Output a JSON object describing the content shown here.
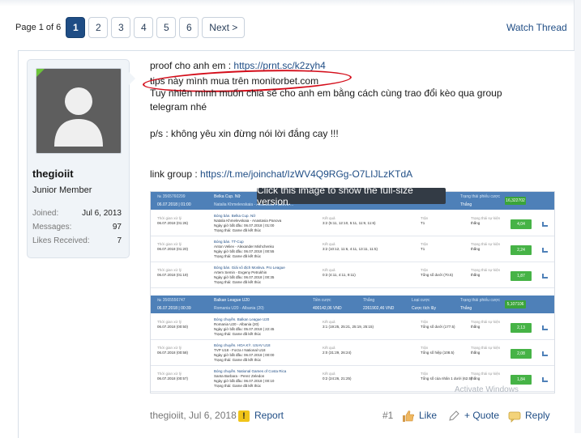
{
  "pagination": {
    "info": "Page 1 of 6",
    "pages": [
      "1",
      "2",
      "3",
      "4",
      "5",
      "6"
    ],
    "active": "1",
    "next": "Next >"
  },
  "watch_thread": "Watch Thread",
  "user": {
    "name": "thegioiit",
    "title": "Junior Member",
    "stats": [
      {
        "label": "Joined:",
        "value": "Jul 6, 2013"
      },
      {
        "label": "Messages:",
        "value": "97"
      },
      {
        "label": "Likes Received:",
        "value": "7"
      }
    ]
  },
  "message": {
    "line1_prefix": "proof cho anh em : ",
    "line1_link": "https://prnt.sc/k2zyh4",
    "line2": "tips này mình mua trên monitorbet.com",
    "line3": "Tuy nhiên mình muốn chia sẽ cho anh em bằng cách cùng trao đổi kèo qua group",
    "line4": "telegram nhé",
    "line5": "p/s : không yêu xin đừng nói lời đắng cay !!!",
    "line6_prefix": "link group : ",
    "line6_link": "https://t.me/joinchat/IzWV4Q9RGg-O7LIJLzKTdA"
  },
  "image": {
    "tooltip": "Click this image to show the full-size version.",
    "watermark": "Activate Windows",
    "blocks": [
      {
        "id": "№ 3565760299",
        "date": "06.07.2018 | 01:00",
        "league": "Belka Cup. Nữ",
        "match": "Natalia Khmelevskaia - Anastasia Panova ...",
        "status_label": "Trạng thái phiếu cược",
        "status": "Thắng",
        "badge": "16,322702",
        "rows": [
          {
            "time_label": "Thời gian xử lý",
            "time": "06.07.2018 (01:26)",
            "sport": "Bóng bàn. Belka Cup. Nữ",
            "teams": "Natalia Khmelevskaia - Anastasia Panova",
            "start": "Ngày giờ bắt đầu: 06.07.2018 | 01:00",
            "state": "Trạng thái: Game đã kết thúc",
            "result_label": "Kết quả",
            "result": "3:2 (5:11, 12:10, 5:11, 11:9, 11:6)",
            "pick_label": "Trận",
            "pick": "T1",
            "event_label": "Trạng thái sự kiện",
            "event": "thắng",
            "odds": "4,04"
          },
          {
            "time_label": "Thời gian xử lý",
            "time": "06.07.2018 (01:20)",
            "sport": "Bóng bàn. TT-Cup",
            "teams": "Anton Veliev - Alexander Mishchenko",
            "start": "Ngày giờ bắt đầu: 06.07.2018 | 00:55",
            "state": "Trạng thái: Game đã kết thúc",
            "result_label": "Kết quả",
            "result": "3:2 (10:12, 11:6, 4:11, 13:11, 11:5)",
            "pick_label": "Trận",
            "pick": "T1",
            "event_label": "Trạng thái sự kiện",
            "event": "thắng",
            "odds": "2,24"
          },
          {
            "time_label": "Thời gian xử lý",
            "time": "06.07.2018 (01:19)",
            "sport": "Bóng bàn. Giải vô địch Moskva. Pro League",
            "teams": "Artem Semin - Evgeny Petrukhin",
            "start": "Ngày giờ bắt đầu: 06.07.2018 | 00:35",
            "state": "Trạng thái: Game đã kết thúc",
            "result_label": "Kết quả",
            "result": "0:3 (4:11, 4:11, 9:11)",
            "pick_label": "Trận",
            "pick": "Tổng số dưới (70.5)",
            "event_label": "Trạng thái sự kiện",
            "event": "thắng",
            "odds": "1,87"
          }
        ]
      },
      {
        "id": "№ 3565556747",
        "date": "06.07.2018 | 00:39",
        "league": "Balkan League U20",
        "match": "Romania U20 - Albania (20)",
        "stake_label": "Tiền cược",
        "stake": "400142,06 VND",
        "win_label": "Thắng",
        "win": "2261902,46 VND",
        "type_label": "Loại cược",
        "type": "Cược tích lũy",
        "status_label": "Trạng thái phiếu cược",
        "status": "Thắng",
        "badge": "5,107106",
        "rows": [
          {
            "time_label": "Thời gian xử lý",
            "time": "06.07.2018 (00:50)",
            "sport": "Bóng chuyền. Balkan League U20",
            "teams": "Romania U20 - Albania (20)",
            "start": "Ngày giờ bắt đầu: 05.07.2018 | 22:45",
            "state": "Trạng thái: Game đã kết thúc",
            "result_label": "Kết quả",
            "result": "3:1 (19:25, 25:21, 25:19, 25:15)",
            "pick_label": "Trận",
            "pick": "Tổng số dưới (177.5)",
            "event_label": "Trạng thái sự kiện",
            "event": "thắng",
            "odds": "2,13"
          },
          {
            "time_label": "Thời gian xử lý",
            "time": "06.07.2018 (00:58)",
            "sport": "Bóng chuyền. HOA KỲ. USAV U18",
            "teams": "TVP U18 - Forza I National U18",
            "start": "Ngày giờ bắt đầu: 06.07.2018 | 00:00",
            "state": "Trạng thái: Game đã kết thúc",
            "result_label": "Kết quả",
            "result": "2:0 (31:29, 26:24)",
            "pick_label": "Trận",
            "pick": "Tổng số hiệp (108.5)",
            "event_label": "Trạng thái sự kiện",
            "event": "thắng",
            "odds": "2,08"
          },
          {
            "time_label": "Thời gian xử lý",
            "time": "06.07.2018 (00:57)",
            "sport": "Bóng chuyền. National Games of Costa Rica",
            "teams": "Santa Barbara - Perez Zeledon",
            "start": "Ngày giờ bắt đầu: 06.07.2018 | 00:10",
            "state": "Trạng thái: Game đã kết thúc",
            "result_label": "Kết quả",
            "result": "0:2 (24:26, 21:25)",
            "pick_label": "Trận",
            "pick": "Tổng số của nhân 1 dưới (62.5)",
            "event_label": "Trạng thái sự kiện",
            "event": "thắng",
            "odds": "1,84"
          }
        ]
      }
    ]
  },
  "footer": {
    "meta": "thegioiit, Jul 6, 2018",
    "report": "Report",
    "post_no": "#1",
    "like": "Like",
    "quote": "+ Quote",
    "reply": "Reply"
  },
  "colors": {
    "accent": "#1f4d85",
    "header_blue": "#4e80b8",
    "green": "#46b346",
    "highlight_red": "#d40d1a"
  }
}
